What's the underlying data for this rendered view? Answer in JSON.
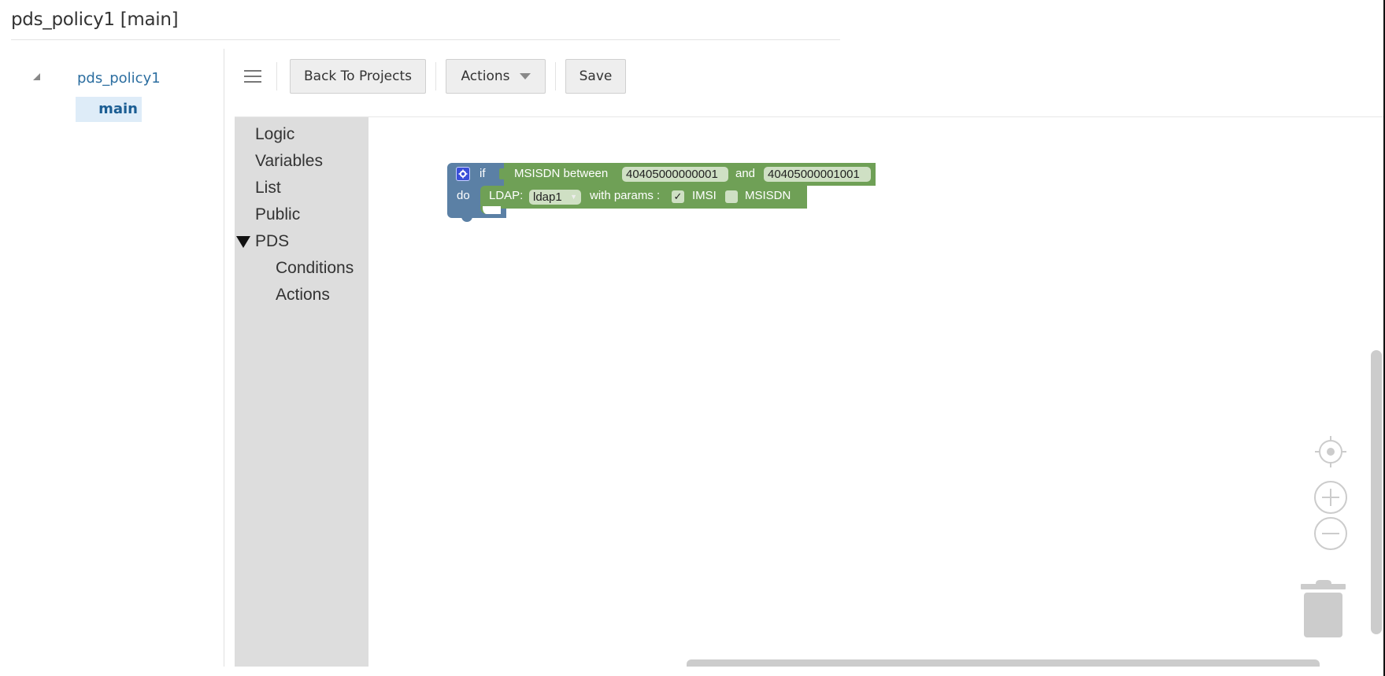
{
  "header": {
    "title": "pds_policy1 [main]"
  },
  "navigator": {
    "root": {
      "label": "pds_policy1",
      "expanded": true
    },
    "children": [
      {
        "label": "main",
        "selected": true
      }
    ]
  },
  "toolbar": {
    "menu_icon": "hamburger-icon",
    "back_label": "Back To Projects",
    "actions_label": "Actions",
    "save_label": "Save"
  },
  "toolbox": {
    "categories": [
      {
        "label": "Logic"
      },
      {
        "label": "Variables"
      },
      {
        "label": "List"
      },
      {
        "label": "Public"
      },
      {
        "label": "PDS",
        "expanded": true,
        "children": [
          {
            "label": "Conditions"
          },
          {
            "label": "Actions"
          }
        ]
      }
    ]
  },
  "workspace": {
    "if_block": {
      "if_label": "if",
      "do_label": "do",
      "colors": {
        "logic": "#5b80a5",
        "pds": "#6fa056"
      }
    },
    "condition_block": {
      "label": "MSISDN between",
      "from_value": "40405000000001",
      "and_label": "and",
      "to_value": "40405000001001"
    },
    "action_block": {
      "label": "LDAP:",
      "ldap_selected": "ldap1",
      "params_label": "with params :",
      "params": [
        {
          "label": "IMSI",
          "checked": true
        },
        {
          "label": "MSISDN",
          "checked": false
        }
      ]
    },
    "controls": [
      "recenter-icon",
      "zoom-in-icon",
      "zoom-out-icon",
      "trash-icon"
    ]
  }
}
